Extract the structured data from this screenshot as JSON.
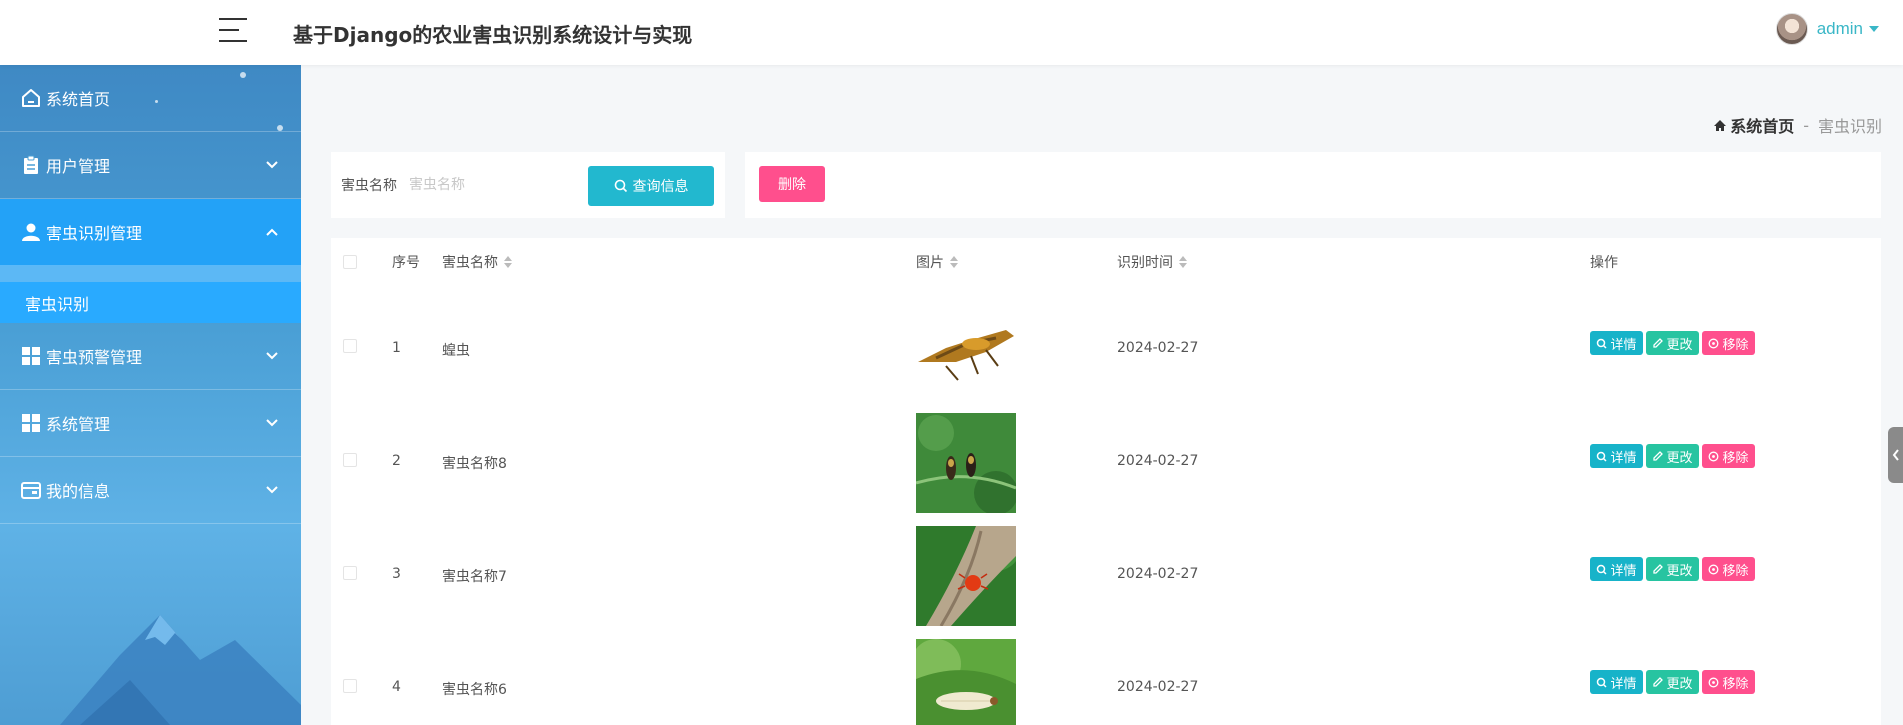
{
  "header": {
    "title": "基于Django的农业害虫识别系统设计与实现",
    "user": "admin"
  },
  "sidebar": {
    "items": [
      {
        "label": "系统首页",
        "icon": "home-icon"
      },
      {
        "label": "用户管理",
        "icon": "clipboard-icon"
      },
      {
        "label": "害虫识别管理",
        "icon": "user-icon"
      },
      {
        "label": "害虫预警管理",
        "icon": "grid-icon"
      },
      {
        "label": "系统管理",
        "icon": "grid-icon"
      },
      {
        "label": "我的信息",
        "icon": "wallet-icon"
      }
    ],
    "subitem": "害虫识别"
  },
  "breadcrumb": {
    "home": "系统首页",
    "separator": "-",
    "current": "害虫识别"
  },
  "search": {
    "label": "害虫名称",
    "placeholder": "害虫名称",
    "query_button": "查询信息",
    "delete_button": "删除"
  },
  "table": {
    "headers": {
      "index": "序号",
      "name": "害虫名称",
      "image": "图片",
      "time": "识别时间",
      "ops": "操作"
    },
    "rows": [
      {
        "index": "1",
        "name": "蝗虫",
        "time": "2024-02-27"
      },
      {
        "index": "2",
        "name": "害虫名称8",
        "time": "2024-02-27"
      },
      {
        "index": "3",
        "name": "害虫名称7",
        "time": "2024-02-27"
      },
      {
        "index": "4",
        "name": "害虫名称6",
        "time": "2024-02-27"
      }
    ],
    "op_labels": {
      "detail": "详情",
      "edit": "更改",
      "remove": "移除"
    }
  },
  "colors": {
    "accent": "#22b8cf",
    "danger": "#ff4f8d",
    "edit": "#27c4a1",
    "sidebar_active": "#23a2f7"
  }
}
